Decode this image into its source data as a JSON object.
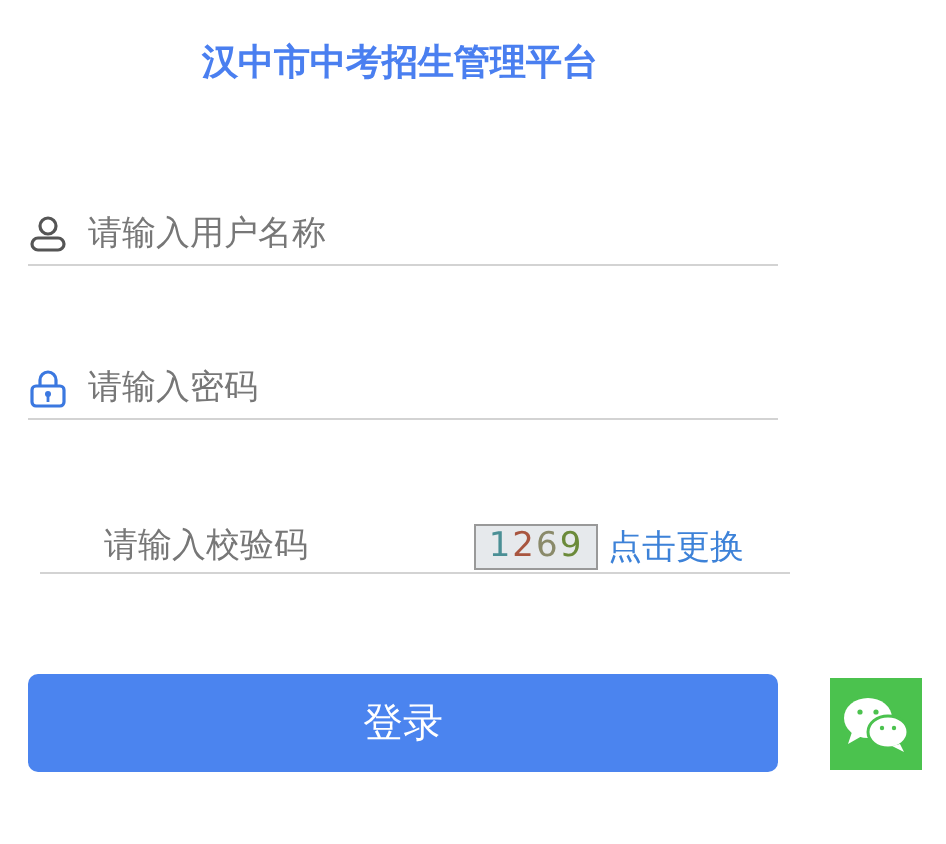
{
  "title": "汉中市中考招生管理平台",
  "fields": [
    {
      "kind": "user",
      "placeholder": "请输入用户名称"
    },
    {
      "kind": "password",
      "placeholder": "请输入密码"
    }
  ],
  "captcha": {
    "placeholder": "请输入校验码",
    "code": "1269",
    "refresh_link": "点击更换"
  },
  "login_button": "登录"
}
